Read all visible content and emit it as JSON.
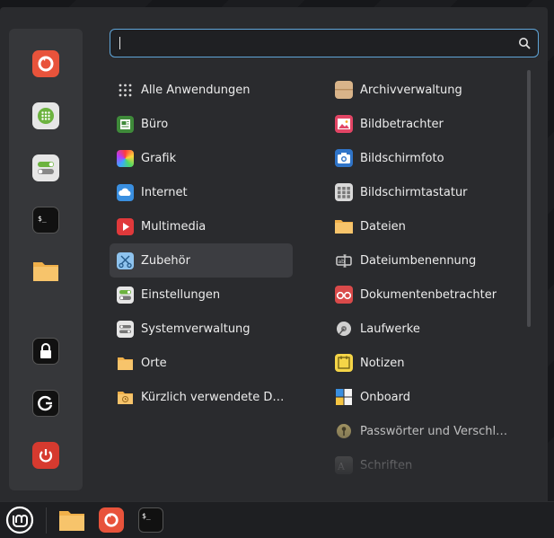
{
  "search": {
    "placeholder": "",
    "value": ""
  },
  "favorites": [
    {
      "name": "firefox"
    },
    {
      "name": "software-manager"
    },
    {
      "name": "system-settings"
    },
    {
      "name": "terminal"
    },
    {
      "name": "files"
    },
    {
      "name": "lock-screen"
    },
    {
      "name": "logout"
    },
    {
      "name": "shutdown"
    }
  ],
  "categories": [
    {
      "label": "Alle Anwendungen",
      "icon": "grid-icon"
    },
    {
      "label": "Büro",
      "icon": "office-icon"
    },
    {
      "label": "Grafik",
      "icon": "graphics-icon"
    },
    {
      "label": "Internet",
      "icon": "cloud-icon"
    },
    {
      "label": "Multimedia",
      "icon": "play-icon"
    },
    {
      "label": "Zubehör",
      "icon": "scissors-icon",
      "active": true
    },
    {
      "label": "Einstellungen",
      "icon": "toggles-icon"
    },
    {
      "label": "Systemverwaltung",
      "icon": "system-icon"
    },
    {
      "label": "Orte",
      "icon": "folder-icon"
    },
    {
      "label": "Kürzlich verwendete Dateien",
      "icon": "recent-folder-icon"
    }
  ],
  "apps": [
    {
      "label": "Archivverwaltung",
      "icon": "archive-icon"
    },
    {
      "label": "Bildbetrachter",
      "icon": "image-viewer-icon"
    },
    {
      "label": "Bildschirmfoto",
      "icon": "camera-icon"
    },
    {
      "label": "Bildschirmtastatur",
      "icon": "keyboard-icon"
    },
    {
      "label": "Dateien",
      "icon": "folder-icon"
    },
    {
      "label": "Dateiumbenennung",
      "icon": "rename-icon"
    },
    {
      "label": "Dokumentenbetrachter",
      "icon": "glasses-icon"
    },
    {
      "label": "Laufwerke",
      "icon": "disk-icon"
    },
    {
      "label": "Notizen",
      "icon": "note-icon"
    },
    {
      "label": "Onboard",
      "icon": "onboard-icon"
    },
    {
      "label": "Passwörter und Verschlüsselung",
      "icon": "key-icon"
    },
    {
      "label": "Schriften",
      "icon": "fonts-icon"
    }
  ],
  "taskbar": [
    {
      "name": "mint-menu"
    },
    {
      "name": "files"
    },
    {
      "name": "firefox"
    },
    {
      "name": "terminal"
    }
  ],
  "colors": {
    "accent": "#5fa5d8",
    "panel": "#2a2b2e",
    "favbar": "#36373a",
    "active_row": "#3c3d41"
  }
}
